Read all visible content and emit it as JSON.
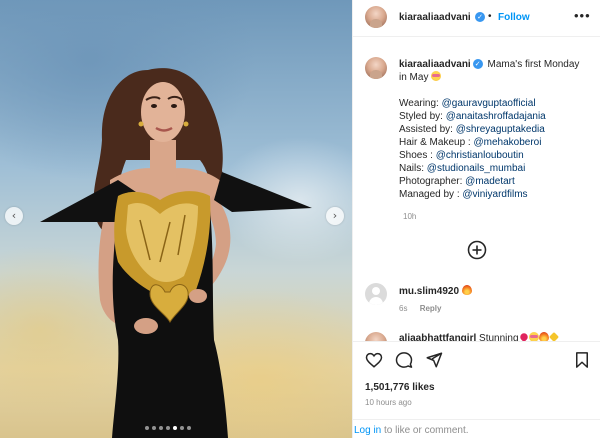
{
  "post": {
    "username": "kiaraaliaadvani",
    "follow_label": "Follow",
    "more_label": "•••",
    "separator": "•",
    "verified_mark": "✓",
    "photo_nav_prev": "‹",
    "photo_nav_next": "›",
    "carousel_total": 7,
    "carousel_active_index": 4
  },
  "caption": {
    "username": "kiaraaliaadvani",
    "text": "Mama's first Monday",
    "text_line2": "in May",
    "emoji_icon": "smiling-face-with-hearts-emoji",
    "credits": [
      {
        "label": "Wearing: ",
        "mention": "@gauravguptaofficial"
      },
      {
        "label": "Styled by: ",
        "mention": "@anaitashroffadajania"
      },
      {
        "label": "Assisted by: ",
        "mention": "@shreyaguptakedia"
      },
      {
        "label": "Hair & Makeup : ",
        "mention": "@mehakoberoi"
      },
      {
        "label": "Shoes : ",
        "mention": "@christianlouboutin"
      },
      {
        "label": "Nails: ",
        "mention": "@studionails_mumbai"
      },
      {
        "label": "Photographer: ",
        "mention": "@madetart"
      },
      {
        "label": "Managed by : ",
        "mention": "@viniyardfilms"
      }
    ],
    "time": "10h"
  },
  "comments": [
    {
      "username": "mu.slim4920",
      "emoji_icon": "fire-emoji",
      "time": "6s",
      "reply_label": "Reply"
    },
    {
      "username": "aliaabhattfangirl",
      "text": "Stunning",
      "emoji_icons": [
        "heart-emoji",
        "smiling-face-with-hearts-emoji",
        "fire-emoji",
        "sparkles-emoji"
      ]
    }
  ],
  "actions": {
    "likes": "1,501,776 likes",
    "time_ago": "10 hours ago",
    "login_link": "Log in",
    "login_text": " to like or comment."
  },
  "colors": {
    "link_blue": "#0095f6",
    "mention_blue": "#00376b",
    "verified_blue": "#3897f0",
    "secondary_text": "#8e8e8e",
    "divider": "#efefef"
  }
}
